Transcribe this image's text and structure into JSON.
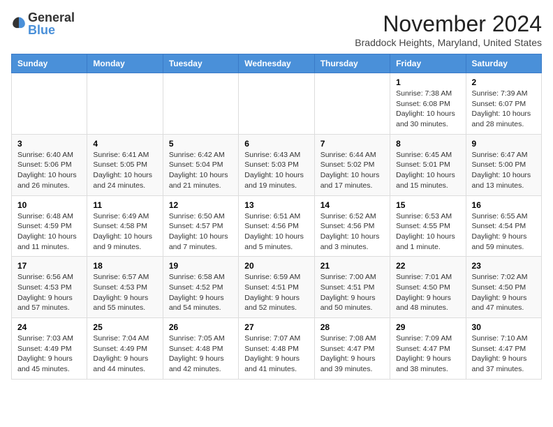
{
  "logo": {
    "general": "General",
    "blue": "Blue"
  },
  "title": "November 2024",
  "subtitle": "Braddock Heights, Maryland, United States",
  "days_header": [
    "Sunday",
    "Monday",
    "Tuesday",
    "Wednesday",
    "Thursday",
    "Friday",
    "Saturday"
  ],
  "weeks": [
    [
      {
        "day": "",
        "info": ""
      },
      {
        "day": "",
        "info": ""
      },
      {
        "day": "",
        "info": ""
      },
      {
        "day": "",
        "info": ""
      },
      {
        "day": "",
        "info": ""
      },
      {
        "day": "1",
        "info": "Sunrise: 7:38 AM\nSunset: 6:08 PM\nDaylight: 10 hours and 30 minutes."
      },
      {
        "day": "2",
        "info": "Sunrise: 7:39 AM\nSunset: 6:07 PM\nDaylight: 10 hours and 28 minutes."
      }
    ],
    [
      {
        "day": "3",
        "info": "Sunrise: 6:40 AM\nSunset: 5:06 PM\nDaylight: 10 hours and 26 minutes."
      },
      {
        "day": "4",
        "info": "Sunrise: 6:41 AM\nSunset: 5:05 PM\nDaylight: 10 hours and 24 minutes."
      },
      {
        "day": "5",
        "info": "Sunrise: 6:42 AM\nSunset: 5:04 PM\nDaylight: 10 hours and 21 minutes."
      },
      {
        "day": "6",
        "info": "Sunrise: 6:43 AM\nSunset: 5:03 PM\nDaylight: 10 hours and 19 minutes."
      },
      {
        "day": "7",
        "info": "Sunrise: 6:44 AM\nSunset: 5:02 PM\nDaylight: 10 hours and 17 minutes."
      },
      {
        "day": "8",
        "info": "Sunrise: 6:45 AM\nSunset: 5:01 PM\nDaylight: 10 hours and 15 minutes."
      },
      {
        "day": "9",
        "info": "Sunrise: 6:47 AM\nSunset: 5:00 PM\nDaylight: 10 hours and 13 minutes."
      }
    ],
    [
      {
        "day": "10",
        "info": "Sunrise: 6:48 AM\nSunset: 4:59 PM\nDaylight: 10 hours and 11 minutes."
      },
      {
        "day": "11",
        "info": "Sunrise: 6:49 AM\nSunset: 4:58 PM\nDaylight: 10 hours and 9 minutes."
      },
      {
        "day": "12",
        "info": "Sunrise: 6:50 AM\nSunset: 4:57 PM\nDaylight: 10 hours and 7 minutes."
      },
      {
        "day": "13",
        "info": "Sunrise: 6:51 AM\nSunset: 4:56 PM\nDaylight: 10 hours and 5 minutes."
      },
      {
        "day": "14",
        "info": "Sunrise: 6:52 AM\nSunset: 4:56 PM\nDaylight: 10 hours and 3 minutes."
      },
      {
        "day": "15",
        "info": "Sunrise: 6:53 AM\nSunset: 4:55 PM\nDaylight: 10 hours and 1 minute."
      },
      {
        "day": "16",
        "info": "Sunrise: 6:55 AM\nSunset: 4:54 PM\nDaylight: 9 hours and 59 minutes."
      }
    ],
    [
      {
        "day": "17",
        "info": "Sunrise: 6:56 AM\nSunset: 4:53 PM\nDaylight: 9 hours and 57 minutes."
      },
      {
        "day": "18",
        "info": "Sunrise: 6:57 AM\nSunset: 4:53 PM\nDaylight: 9 hours and 55 minutes."
      },
      {
        "day": "19",
        "info": "Sunrise: 6:58 AM\nSunset: 4:52 PM\nDaylight: 9 hours and 54 minutes."
      },
      {
        "day": "20",
        "info": "Sunrise: 6:59 AM\nSunset: 4:51 PM\nDaylight: 9 hours and 52 minutes."
      },
      {
        "day": "21",
        "info": "Sunrise: 7:00 AM\nSunset: 4:51 PM\nDaylight: 9 hours and 50 minutes."
      },
      {
        "day": "22",
        "info": "Sunrise: 7:01 AM\nSunset: 4:50 PM\nDaylight: 9 hours and 48 minutes."
      },
      {
        "day": "23",
        "info": "Sunrise: 7:02 AM\nSunset: 4:50 PM\nDaylight: 9 hours and 47 minutes."
      }
    ],
    [
      {
        "day": "24",
        "info": "Sunrise: 7:03 AM\nSunset: 4:49 PM\nDaylight: 9 hours and 45 minutes."
      },
      {
        "day": "25",
        "info": "Sunrise: 7:04 AM\nSunset: 4:49 PM\nDaylight: 9 hours and 44 minutes."
      },
      {
        "day": "26",
        "info": "Sunrise: 7:05 AM\nSunset: 4:48 PM\nDaylight: 9 hours and 42 minutes."
      },
      {
        "day": "27",
        "info": "Sunrise: 7:07 AM\nSunset: 4:48 PM\nDaylight: 9 hours and 41 minutes."
      },
      {
        "day": "28",
        "info": "Sunrise: 7:08 AM\nSunset: 4:47 PM\nDaylight: 9 hours and 39 minutes."
      },
      {
        "day": "29",
        "info": "Sunrise: 7:09 AM\nSunset: 4:47 PM\nDaylight: 9 hours and 38 minutes."
      },
      {
        "day": "30",
        "info": "Sunrise: 7:10 AM\nSunset: 4:47 PM\nDaylight: 9 hours and 37 minutes."
      }
    ]
  ]
}
